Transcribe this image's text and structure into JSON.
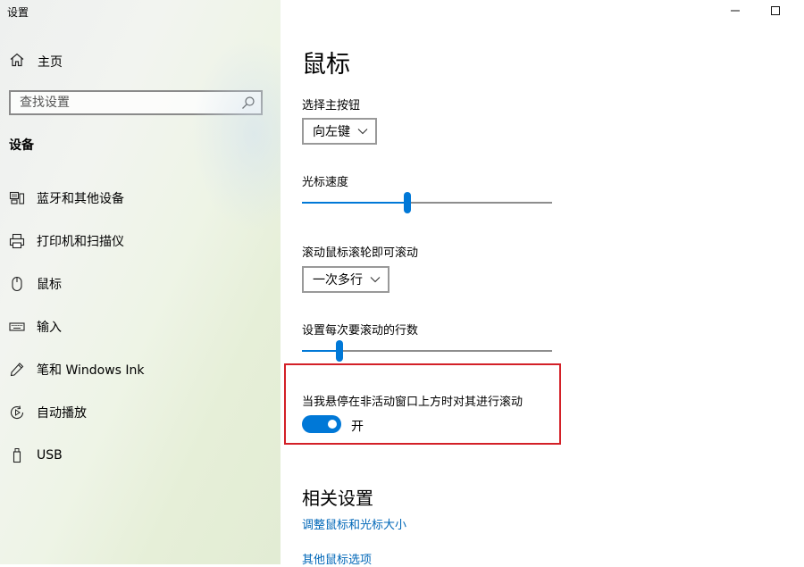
{
  "window": {
    "title": "设置",
    "minimize_glyph": "—",
    "maximize_glyph": "☐"
  },
  "sidebar": {
    "home_label": "主页",
    "search_placeholder": "查找设置",
    "section_title": "设备",
    "items": [
      {
        "label": "蓝牙和其他设备",
        "icon": "bluetooth-devices-icon"
      },
      {
        "label": "打印机和扫描仪",
        "icon": "printer-icon"
      },
      {
        "label": "鼠标",
        "icon": "mouse-icon"
      },
      {
        "label": "输入",
        "icon": "keyboard-icon"
      },
      {
        "label": "笔和 Windows Ink",
        "icon": "pen-icon"
      },
      {
        "label": "自动播放",
        "icon": "autoplay-icon"
      },
      {
        "label": "USB",
        "icon": "usb-icon"
      }
    ]
  },
  "main": {
    "title": "鼠标",
    "primary_button": {
      "label": "选择主按钮",
      "value": "向左键"
    },
    "cursor_speed": {
      "label": "光标速度",
      "value": 0.42
    },
    "scroll_mode": {
      "label": "滚动鼠标滚轮即可滚动",
      "value": "一次多行"
    },
    "scroll_lines": {
      "label": "设置每次要滚动的行数",
      "value": 0.15
    },
    "inactive_scroll": {
      "label": "当我悬停在非活动窗口上方时对其进行滚动",
      "state": "开",
      "on": true
    },
    "related": {
      "title": "相关设置",
      "links": [
        "调整鼠标和光标大小",
        "其他鼠标选项"
      ]
    }
  },
  "colors": {
    "accent": "#0078d7",
    "link": "#0067b8",
    "highlight": "#d32027"
  }
}
